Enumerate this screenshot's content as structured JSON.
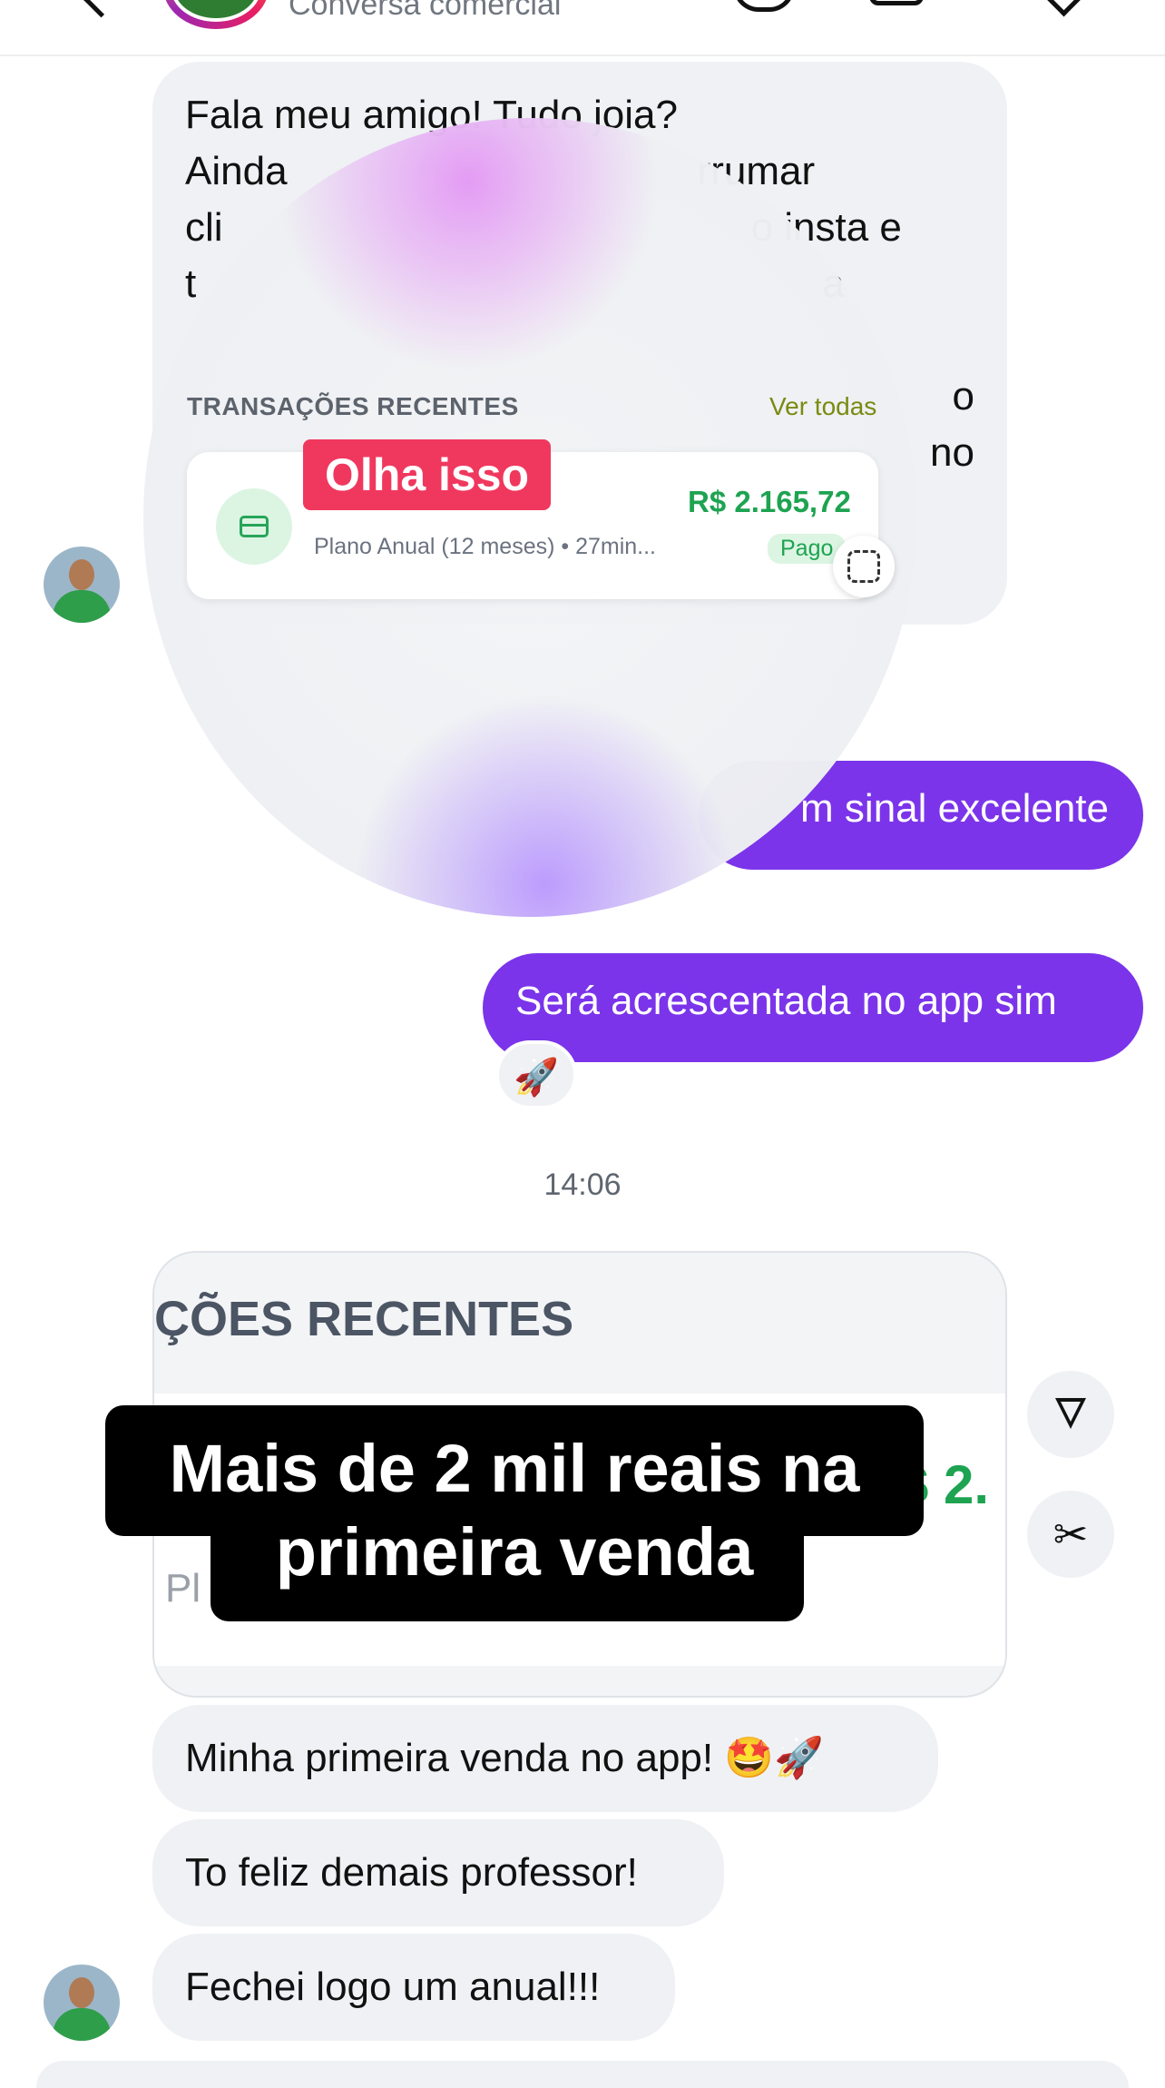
{
  "header": {
    "subtitle": "Conversa comercial",
    "icons": [
      "back-icon",
      "avatar",
      "call-icon",
      "video-icon",
      "tag-icon"
    ]
  },
  "messages": {
    "first_incoming": {
      "lines": [
        "Fala meu amigo! Tudo joia?",
        "Ainda",
        "rrumar",
        "cli",
        "o insta e",
        "t",
        "a",
        "o",
        "no"
      ]
    },
    "out_1": "m sinal excelente",
    "out_2": "Será acrescentada no app sim",
    "out_2_reaction": "🚀",
    "timestamp": "14:06",
    "in_a": "Minha primeira venda no app! 🤩🚀",
    "in_b": "To feliz demais professor!",
    "in_c": "Fechei logo um anual!!!"
  },
  "overlay": {
    "section_title": "TRANSAÇÕES RECENTES",
    "see_all": "Ver todas",
    "transaction": {
      "description": "Plano Anual (12 meses) • 27min...",
      "amount": "R$ 2.165,72",
      "status": "Pago"
    },
    "callout": "Olha isso"
  },
  "image_message": {
    "title": "ÇÕES RECENTES",
    "amount_fragment": "$ 2.",
    "desc_fragment": "Pl",
    "caption_line1": "Mais de 2 mil reais na",
    "caption_line2": "primeira venda"
  },
  "colors": {
    "outgoing_bubble": "#7b34ea",
    "incoming_bubble": "#eff1f4",
    "callout": "#f0385e",
    "amount_green": "#1ea351",
    "see_all": "#7a8a10"
  }
}
